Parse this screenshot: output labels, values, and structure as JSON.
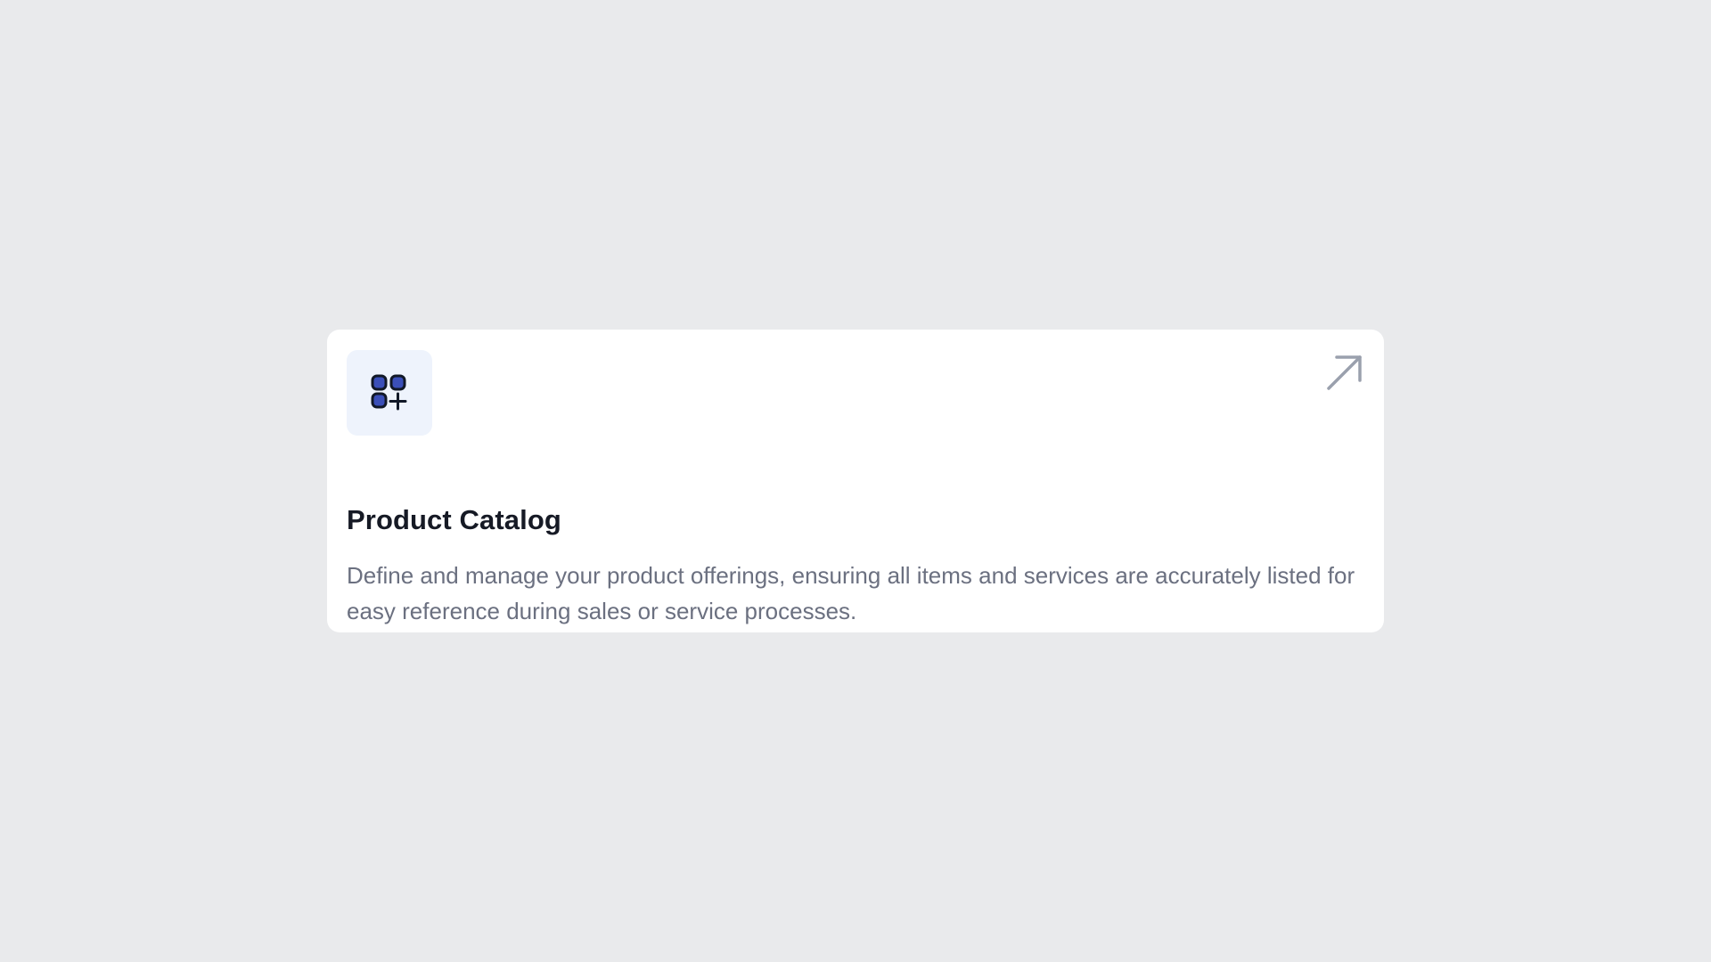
{
  "card": {
    "title": "Product Catalog",
    "description": "Define and manage your product offerings, ensuring all items and services are accurately listed for easy reference during sales or service processes.",
    "icon": "apps-add-icon",
    "link_icon": "arrow-up-right-icon"
  },
  "colors": {
    "background": "#e9eaec",
    "card": "#ffffff",
    "icon_tile": "#eef3fc",
    "icon_fill": "#3b4fb8",
    "icon_stroke": "#111827",
    "title": "#161a25",
    "description": "#6b7080",
    "arrow": "#9aa0ad"
  }
}
